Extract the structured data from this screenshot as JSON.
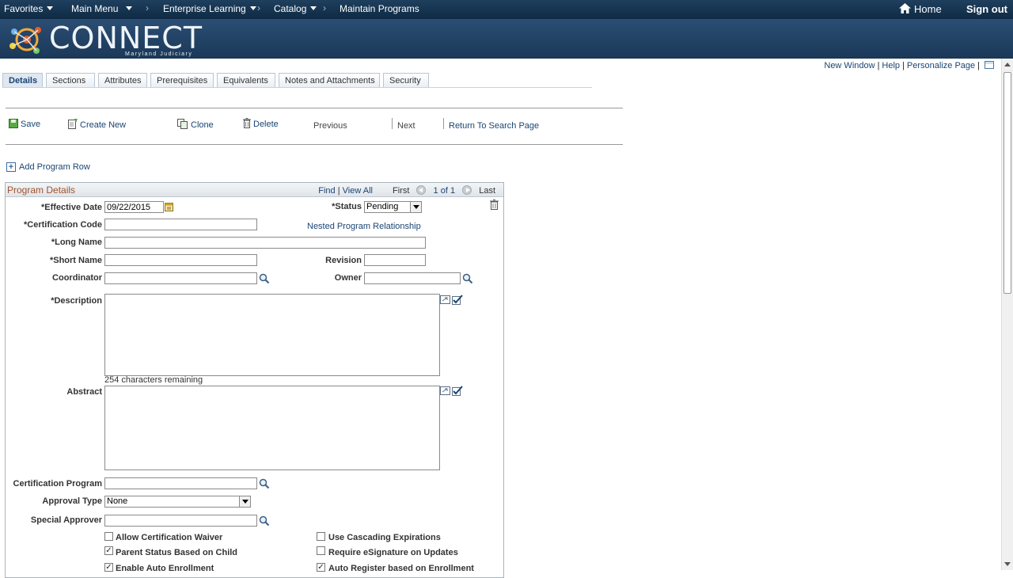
{
  "topnav": {
    "favorites": "Favorites",
    "main_menu": "Main Menu",
    "enterprise_learning": "Enterprise Learning",
    "catalog": "Catalog",
    "maintain_programs": "Maintain Programs",
    "home": "Home",
    "sign_out": "Sign out",
    "separator": "›"
  },
  "banner": {
    "logo_text": "CONNECT",
    "logo_subtext": "Maryland Judiciary"
  },
  "page_links": {
    "new_window": "New Window",
    "help": "Help",
    "personalize": "Personalize Page",
    "bar": "|"
  },
  "tabs": [
    {
      "label": "Details",
      "active": true
    },
    {
      "label": "Sections"
    },
    {
      "label": "Attributes"
    },
    {
      "label": "Prerequisites"
    },
    {
      "label": "Equivalents"
    },
    {
      "label": "Notes and Attachments"
    },
    {
      "label": "Security"
    }
  ],
  "toolbar": {
    "save": "Save",
    "create_new": "Create New",
    "clone": "Clone",
    "delete": "Delete",
    "previous": "Previous",
    "next": "Next",
    "return_to_search": "Return To Search Page"
  },
  "add_program_row": "Add Program Row",
  "group": {
    "title": "Program Details",
    "find": "Find",
    "bar": "|",
    "view_all": "View All",
    "first": "First",
    "count": "1 of 1",
    "last": "Last"
  },
  "form": {
    "effective_date_label": "*Effective Date",
    "effective_date_value": "09/22/2015",
    "status_label": "*Status",
    "status_value": "Pending",
    "certification_code_label": "*Certification Code",
    "certification_code_value": "",
    "nested_link": "Nested Program Relationship",
    "long_name_label": "*Long Name",
    "short_name_label": "*Short Name",
    "revision_label": "Revision",
    "coordinator_label": "Coordinator",
    "owner_label": "Owner",
    "description_label": "*Description",
    "chars_remaining": "254 characters remaining",
    "abstract_label": "Abstract",
    "certification_program_label": "Certification Program",
    "approval_type_label": "Approval Type",
    "approval_type_value": "None",
    "special_approver_label": "Special Approver"
  },
  "checkboxes": [
    {
      "label": "Allow Certification Waiver",
      "checked": false
    },
    {
      "label": "Use Cascading Expirations",
      "checked": false
    },
    {
      "label": "Parent Status Based on Child",
      "checked": true
    },
    {
      "label": "Require eSignature on Updates",
      "checked": false
    },
    {
      "label": "Enable Auto Enrollment",
      "checked": true
    },
    {
      "label": "Auto Register based on Enrollment",
      "checked": true
    }
  ],
  "checkmark": "✓",
  "colors": {
    "nav_bg": "#0f2a44",
    "banner_bg": "#1b3858",
    "link": "#1a4473",
    "group_title": "#a0522d"
  }
}
